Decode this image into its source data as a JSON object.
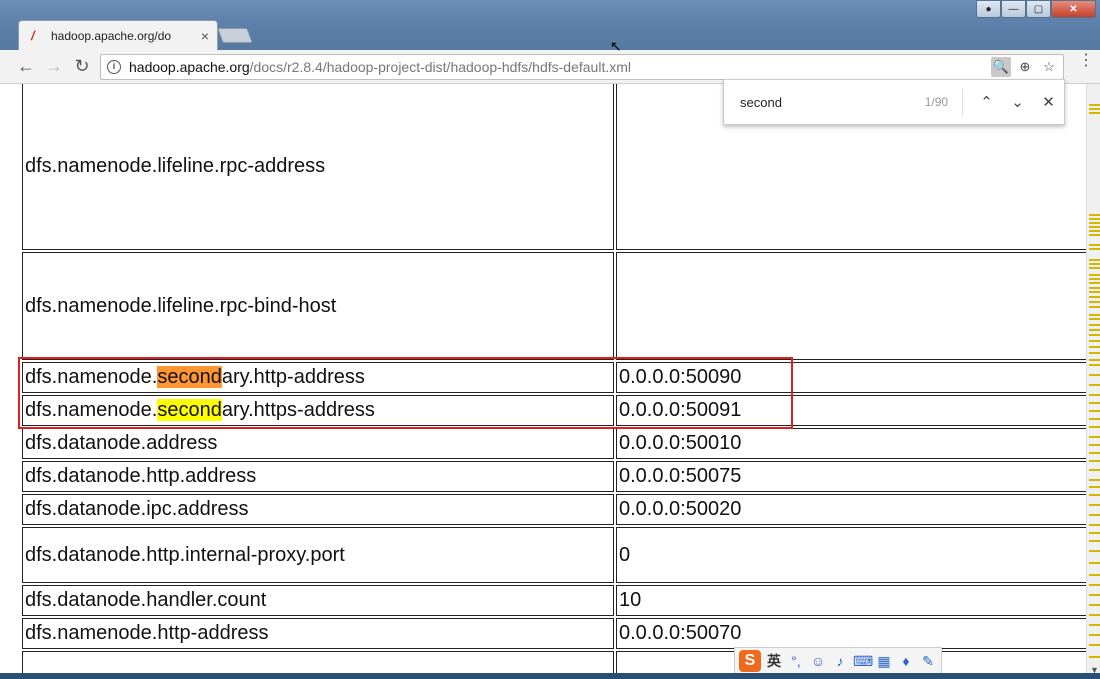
{
  "browser": {
    "tab_title": "hadoop.apache.org/do",
    "url_host": "hadoop.apache.org",
    "url_path": "/docs/r2.8.4/hadoop-project-dist/hadoop-hdfs/hdfs-default.xml"
  },
  "find": {
    "query": "second",
    "count": "1/90"
  },
  "table": {
    "rows": [
      {
        "name": "dfs.namenode.lifeline.rpc-address",
        "value": ""
      },
      {
        "name": "dfs.namenode.lifeline.rpc-bind-host",
        "value": ""
      },
      {
        "name_prefix": "dfs.namenode.",
        "name_match": "second",
        "name_suffix": "ary.http-address",
        "value": "0.0.0.0:50090"
      },
      {
        "name_prefix": "dfs.namenode.",
        "name_match": "second",
        "name_suffix": "ary.https-address",
        "value": "0.0.0.0:50091"
      },
      {
        "name": "dfs.datanode.address",
        "value": "0.0.0.0:50010"
      },
      {
        "name": "dfs.datanode.http.address",
        "value": "0.0.0.0:50075"
      },
      {
        "name": "dfs.datanode.ipc.address",
        "value": "0.0.0.0:50020"
      },
      {
        "name": "dfs.datanode.http.internal-proxy.port",
        "value": "0"
      },
      {
        "name": "dfs.datanode.handler.count",
        "value": "10"
      },
      {
        "name": "dfs.namenode.http-address",
        "value": "0.0.0.0:50070"
      }
    ]
  },
  "ime": {
    "logo": "S",
    "lang": "英"
  },
  "colors": {
    "current_match": "#ff9632",
    "other_match": "#ffff00",
    "annotation_box": "#e02020"
  }
}
